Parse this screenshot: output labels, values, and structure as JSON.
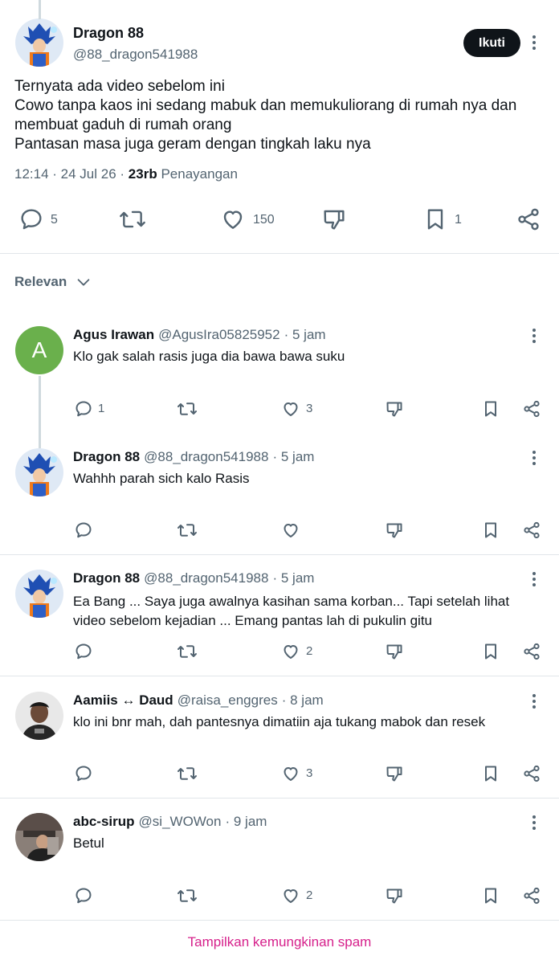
{
  "main_post": {
    "author_name": "Dragon 88",
    "author_handle": "@88_dragon541988",
    "follow_label": "Ikuti",
    "text_lines": [
      "Ternyata ada video sebelom ini",
      "Cowo tanpa kaos ini sedang mabuk dan memukuliorang di rumah nya dan",
      "membuat gaduh di rumah orang",
      "Pantasan masa juga geram dengan tingkah laku nya"
    ],
    "time": "12:14",
    "date": "24 Jul 26",
    "views_count": "23rb",
    "views_label": "Penayangan",
    "reply_count": "5",
    "like_count": "150",
    "bookmark_count": "1"
  },
  "sort": {
    "label": "Relevan"
  },
  "replies": [
    {
      "name": "Agus Irawan",
      "handle": "@AgusIra05825952",
      "time": "5 jam",
      "text_lines": [
        "Klo gak salah rasis juga dia bawa bawa suku"
      ],
      "reply_count": "1",
      "like_count": "3",
      "avatar_letter": "A",
      "avatar_color": "#6ab04c"
    },
    {
      "name": "Dragon 88",
      "handle": "@88_dragon541988",
      "time": "5 jam",
      "text_lines": [
        "Wahhh parah sich kalo Rasis"
      ],
      "reply_count": "",
      "like_count": ""
    },
    {
      "name": "Dragon 88",
      "handle": "@88_dragon541988",
      "time": "5 jam",
      "text_lines": [
        "Ea Bang ... Saya juga awalnya kasihan sama korban... Tapi setelah lihat",
        "video sebelom kejadian ... Emang pantas lah di pukulin gitu"
      ],
      "reply_count": "",
      "like_count": "2"
    },
    {
      "name": "Aamiis ↔ Daud",
      "handle": "@raisa_enggres",
      "time": "8 jam",
      "text_lines": [
        "klo ini bnr mah, dah pantesnya dimatiin aja  tukang mabok dan resek"
      ],
      "reply_count": "",
      "like_count": "3"
    },
    {
      "name": "abc-sirup",
      "handle": "@si_WOWon",
      "time": "9 jam",
      "text_lines": [
        "Betul"
      ],
      "reply_count": "",
      "like_count": "2"
    }
  ],
  "spam_link": "Tampilkan kemungkinan spam",
  "colors": {
    "text": "#0f1419",
    "muted": "#536471",
    "divider": "#e1e6ea",
    "spam_link": "#d6208b",
    "follow_button": "#0f1419"
  }
}
